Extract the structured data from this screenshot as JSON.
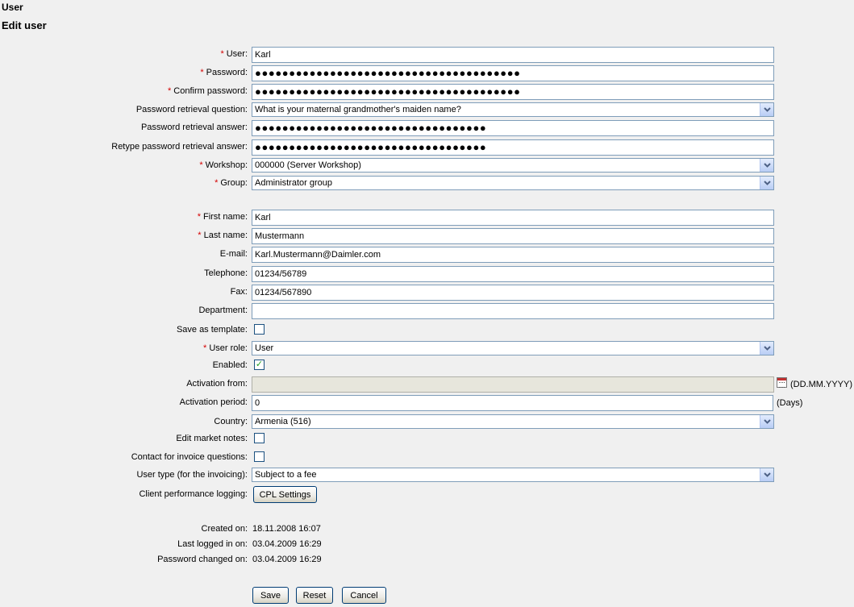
{
  "header": {
    "section": "User",
    "title": "Edit user"
  },
  "form": {
    "user": {
      "label": "User:",
      "value": "Karl",
      "required": "*"
    },
    "password": {
      "label": "Password:",
      "value": "●●●●●●●●●●●●●●●●●●●●●●●●●●●●●●●●●●●●●●●",
      "required": "*"
    },
    "confirm_password": {
      "label": "Confirm password:",
      "value": "●●●●●●●●●●●●●●●●●●●●●●●●●●●●●●●●●●●●●●●",
      "required": "*"
    },
    "retrieval_question": {
      "label": "Password retrieval question:",
      "value": "What is your maternal grandmother's maiden name?"
    },
    "retrieval_answer": {
      "label": "Password retrieval answer:",
      "value": "●●●●●●●●●●●●●●●●●●●●●●●●●●●●●●●●●●"
    },
    "retype_retrieval_answer": {
      "label": "Retype password retrieval answer:",
      "value": "●●●●●●●●●●●●●●●●●●●●●●●●●●●●●●●●●●"
    },
    "workshop": {
      "label": "Workshop:",
      "value": "000000 (Server Workshop)",
      "required": "*"
    },
    "group": {
      "label": "Group:",
      "value": "Administrator group",
      "required": "*"
    },
    "first_name": {
      "label": "First name:",
      "value": "Karl",
      "required": "*"
    },
    "last_name": {
      "label": "Last name:",
      "value": "Mustermann",
      "required": "*"
    },
    "email": {
      "label": "E-mail:",
      "value": "Karl.Mustermann@Daimler.com"
    },
    "telephone": {
      "label": "Telephone:",
      "value": "01234/56789"
    },
    "fax": {
      "label": "Fax:",
      "value": "01234/567890"
    },
    "department": {
      "label": "Department:",
      "value": ""
    },
    "save_as_template": {
      "label": "Save as template:",
      "checked": false
    },
    "user_role": {
      "label": "User role:",
      "value": "User",
      "required": "*"
    },
    "enabled": {
      "label": "Enabled:",
      "checked": true,
      "mark": "✓"
    },
    "activation_from": {
      "label": "Activation from:",
      "value": "",
      "suffix": "(DD.MM.YYYY)"
    },
    "activation_period": {
      "label": "Activation period:",
      "value": "0",
      "suffix": "(Days)"
    },
    "country": {
      "label": "Country:",
      "value": "Armenia (516)"
    },
    "edit_market_notes": {
      "label": "Edit market notes:",
      "checked": false
    },
    "contact_invoice": {
      "label": "Contact for invoice questions:",
      "checked": false
    },
    "user_type": {
      "label": "User type (for the invoicing):",
      "value": "Subject to a fee"
    },
    "cpl": {
      "label": "Client performance logging:",
      "button": "CPL Settings"
    },
    "created_on": {
      "label": "Created on:",
      "value": "18.11.2008 16:07"
    },
    "last_logged_in": {
      "label": "Last logged in on:",
      "value": "03.04.2009 16:29"
    },
    "password_changed": {
      "label": "Password changed on:",
      "value": "03.04.2009 16:29"
    }
  },
  "actions": {
    "save": "Save",
    "reset": "Reset",
    "cancel": "Cancel"
  },
  "icons": {
    "dropdown": "chevron-down-icon",
    "calendar": "calendar-icon",
    "check": "check-icon"
  },
  "colors": {
    "background": "#f0f0f0",
    "required": "#d40000",
    "input_border": "#7f9db9",
    "check": "#21a121"
  }
}
